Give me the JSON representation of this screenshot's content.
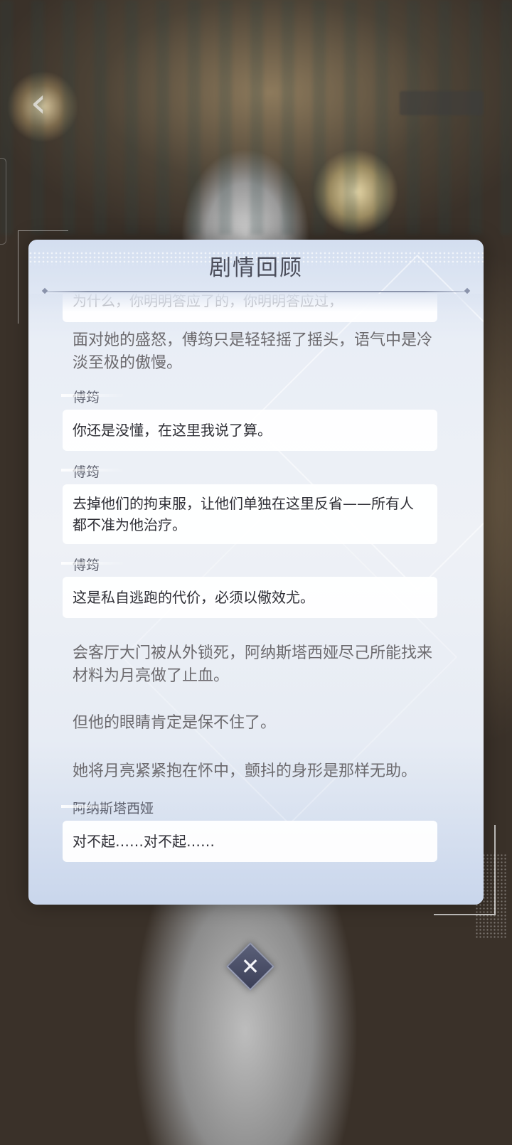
{
  "panel": {
    "title": "剧情回顾"
  },
  "story": {
    "top_card_text": "为什么，你明明答应了的，你明明答应过，",
    "narration_1": "面对她的盛怒，傅筠只是轻轻摇了摇头，语气中是冷淡至极的傲慢。",
    "dialogues": [
      {
        "speaker": "傅筠",
        "text": "你还是没懂，在这里我说了算。"
      },
      {
        "speaker": "傅筠",
        "text": "去掉他们的拘束服，让他们单独在这里反省——所有人都不准为他治疗。"
      },
      {
        "speaker": "傅筠",
        "text": "这是私自逃跑的代价，必须以儆效尤。"
      }
    ],
    "narration_2": "会客厅大门被从外锁死，阿纳斯塔西娅尽己所能找来材料为月亮做了止血。",
    "narration_3": "但他的眼睛肯定是保不住了。",
    "narration_4": "她将月亮紧紧抱在怀中，颤抖的身形是那样无助。",
    "last_dialogue": {
      "speaker": "阿纳斯塔西娅",
      "text": "对不起……对不起……"
    }
  },
  "icons": {
    "back": "chevron-left-icon",
    "close": "close-icon"
  },
  "colors": {
    "panel_top": "#d3def0",
    "panel_bottom": "#c9d6ec",
    "title": "#4b4d5a",
    "narration": "#6c6a6e",
    "dialogue": "#2f2f36",
    "close_button": "#4a4f68"
  }
}
